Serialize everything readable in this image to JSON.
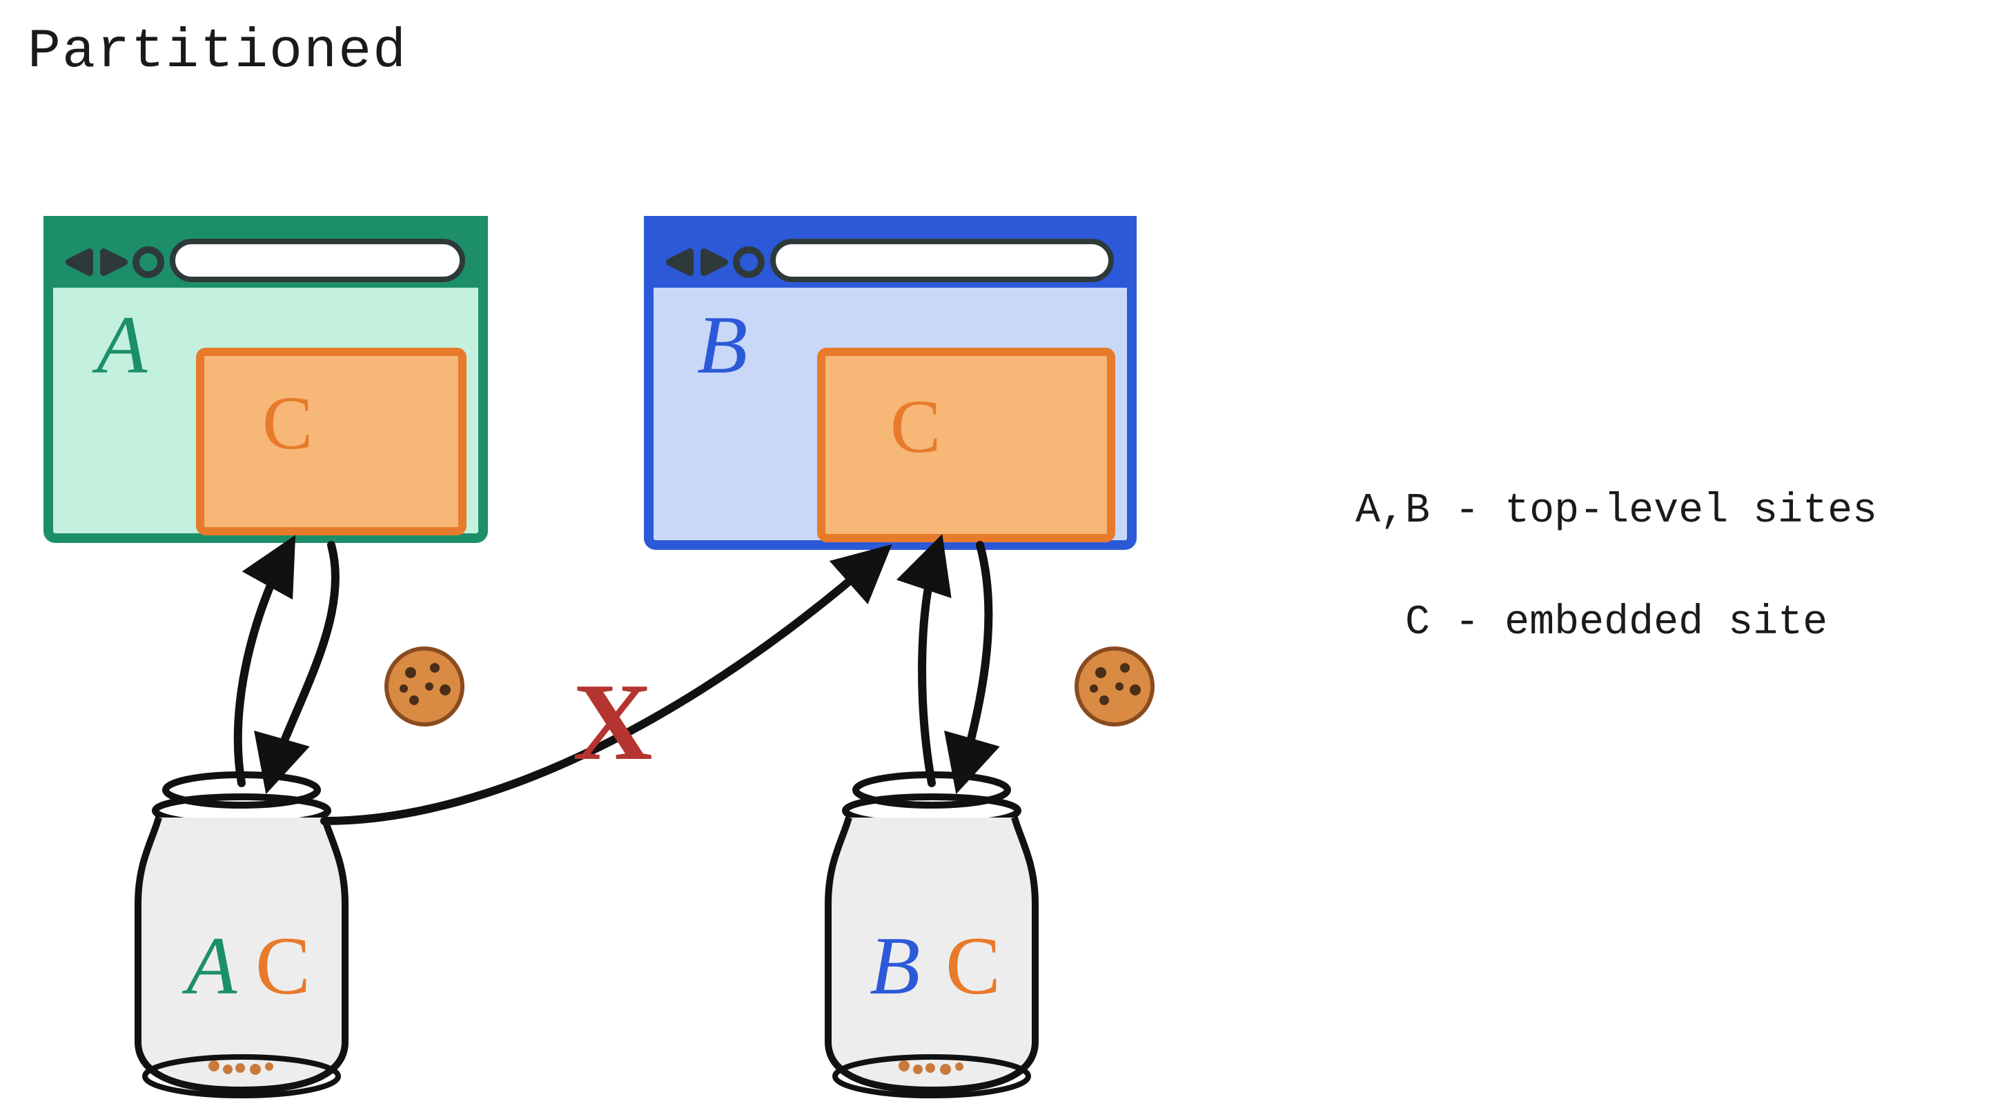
{
  "title": "Partitioned",
  "legend_line1": "A,B - top-level sites",
  "legend_line2": "  C - embedded site",
  "browserA": {
    "label": "A",
    "embedLabel": "C",
    "color": "#1C8F6A",
    "fill": "#C3F1DE"
  },
  "browserB": {
    "label": "B",
    "embedLabel": "C",
    "color": "#2C59D8",
    "fill": "#C9D8F7"
  },
  "embed": {
    "color": "#E77A2B",
    "fill": "#F6B777"
  },
  "jarA": {
    "label1": "A",
    "label2": "C"
  },
  "jarB": {
    "label1": "B",
    "label2": "C"
  },
  "blockMark": "X",
  "colors": {
    "green": "#1C8F6A",
    "blue": "#2C59D8",
    "orange": "#E77A2B",
    "red": "#B5342F",
    "ink": "#111111",
    "glass": "#EDEDED",
    "cookie": "#C97A3A",
    "chip": "#4A2E17"
  }
}
